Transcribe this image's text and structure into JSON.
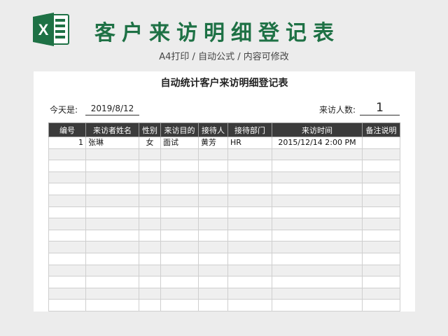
{
  "header": {
    "logo_letter": "X",
    "title": "客户来访明细登记表",
    "subtitle": "A4打印 / 自动公式 / 内容可修改"
  },
  "sheet": {
    "title": "自动统计客户来访明细登记表",
    "today_label": "今天是:",
    "today_value": "2019/8/12",
    "count_label": "来访人数:",
    "count_value": "1"
  },
  "table": {
    "headers": [
      "编号",
      "来访者姓名",
      "性别",
      "来访目的",
      "接待人",
      "接待部门",
      "来访时间",
      "备注说明"
    ],
    "rows": [
      [
        "1",
        "张琳",
        "女",
        "面试",
        "黄芳",
        "HR",
        "2015/12/14 2:00 PM",
        ""
      ]
    ]
  },
  "colors": {
    "brand_green": "#1e7145",
    "header_bg": "#3b3b3b",
    "stripe": "#efefef"
  },
  "icons": [
    "excel-logo-icon"
  ]
}
